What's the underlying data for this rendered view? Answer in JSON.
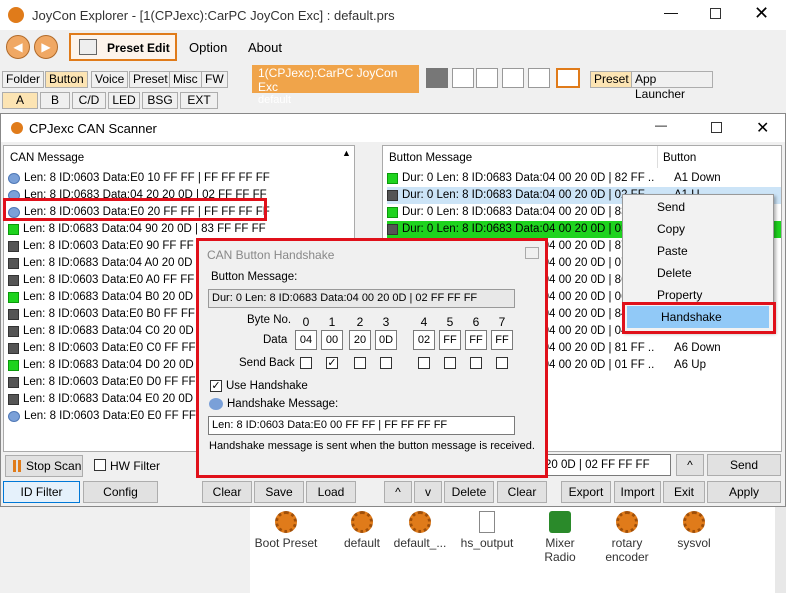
{
  "window_title": "JoyCon Explorer - [1(CPJexc):CarPC JoyCon Exc] : default.prs",
  "menu": {
    "preset_edit": "Preset Edit",
    "option": "Option",
    "about": "About"
  },
  "category_tabs": [
    "Folder",
    "Button",
    "Voice",
    "Preset",
    "Misc",
    "FW"
  ],
  "sub_tabs": [
    "A",
    "B",
    "C/D",
    "LED",
    "BSG",
    "EXT"
  ],
  "doc_tab": {
    "title": "1(CPJexc):CarPC JoyCon Exc",
    "subtitle": "default"
  },
  "right_tabs": [
    "Preset",
    "App Launcher"
  ],
  "scanner": {
    "title": "CPJexc CAN Scanner",
    "can_header": "CAN Message",
    "can_rows": [
      {
        "text": "Len: 8 ID:0603 Data:E0 10 FF FF | FF FF FF FF",
        "icon": "blue"
      },
      {
        "text": "Len: 8 ID:0683 Data:04 20 20 0D | 02 FF FF FF",
        "icon": "blue"
      },
      {
        "text": "Len: 8 ID:0603 Data:E0 20 FF FF | FF FF FF FF",
        "icon": "blue"
      },
      {
        "text": "Len: 8 ID:0683 Data:04 90 20 0D | 83 FF FF FF",
        "icon": "green"
      },
      {
        "text": "Len: 8 ID:0603 Data:E0 90 FF FF | F",
        "icon": "dark"
      },
      {
        "text": "Len: 8 ID:0683 Data:04 A0 20 0D | 0",
        "icon": "dark"
      },
      {
        "text": "Len: 8 ID:0603 Data:E0 A0 FF FF | F",
        "icon": "dark"
      },
      {
        "text": "Len: 8 ID:0683 Data:04 B0 20 0D | 8",
        "icon": "green"
      },
      {
        "text": "Len: 8 ID:0603 Data:E0 B0 FF FF | F",
        "icon": "dark"
      },
      {
        "text": "Len: 8 ID:0683 Data:04 C0 20 0D | 8",
        "icon": "dark"
      },
      {
        "text": "Len: 8 ID:0603 Data:E0 C0 FF FF | F",
        "icon": "dark"
      },
      {
        "text": "Len: 8 ID:0683 Data:04 D0 20 0D | 8",
        "icon": "green"
      },
      {
        "text": "Len: 8 ID:0603 Data:E0 D0 FF FF | F",
        "icon": "dark"
      },
      {
        "text": "Len: 8 ID:0683 Data:04 E0 20 0D | 0",
        "icon": "dark"
      },
      {
        "text": "Len: 8 ID:0603 Data:E0 E0 FF FF | F",
        "icon": "blue"
      }
    ],
    "btn_header": "Button Message",
    "btn_col_header": "Button",
    "btn_rows": [
      {
        "text": "Dur:  0 Len: 8 ID:0683 Data:04 00 20 0D | 82 FF ...",
        "btn": "A1 Down",
        "icon": "green"
      },
      {
        "text": "Dur:  0 Len: 8 ID:0683 Data:04 00 20 0D | 02 FF",
        "btn": "A1 U",
        "icon": "dark"
      },
      {
        "text": "Dur:  0 Len: 8 ID:0683 Data:04 00 20 0D | 83",
        "btn": "",
        "icon": "green"
      },
      {
        "text": "Dur:  0 Len: 8 ID:0683 Data:04 00 20 0D | 03",
        "btn": "",
        "icon": "dark"
      },
      {
        "text": "Dur:  0 Len: 8 ID:0683 Data:04 00 20 0D | 87",
        "btn": "",
        "icon": "green"
      },
      {
        "text": "Dur:  0 Len: 8 ID:0683 Data:04 00 20 0D | 07",
        "btn": "",
        "icon": "dark"
      },
      {
        "text": "Dur:  0 Len: 8 ID:0683 Data:04 00 20 0D | 86",
        "btn": "",
        "icon": "green"
      },
      {
        "text": "Dur:  0 Len: 8 ID:0683 Data:04 00 20 0D | 06",
        "btn": "",
        "icon": "dark"
      },
      {
        "text": "Dur:  0 Len: 8 ID:0683 Data:04 00 20 0D | 84",
        "btn": "",
        "icon": "green"
      },
      {
        "text": "Dur:  0 Len: 8 ID:0683 Data:04 00 20 0D | 04",
        "btn": "",
        "icon": "dark"
      },
      {
        "text": "Dur:  0 Len: 8 ID:0683 Data:04 00 20 0D | 81 FF ...",
        "btn": "A6 Down",
        "icon": "green"
      },
      {
        "text": "Dur:  0 Len: 8 ID:0683 Data:04 00 20 0D | 01 FF ...",
        "btn": "A6 Up",
        "icon": "dark"
      }
    ],
    "stop_scan": "Stop Scan",
    "hw_filter": "HW Filter",
    "id_filter": "ID Filter",
    "config": "Config",
    "clear": "Clear",
    "save": "Save",
    "load": "Load",
    "up": "^",
    "down": "v",
    "delete": "Delete",
    "clear2": "Clear",
    "export": "Export",
    "import": "Import",
    "exit": "Exit",
    "apply": "Apply",
    "send_field": "20 0D | 02 FF FF FF",
    "send": "Send",
    "send_up": "^"
  },
  "context_menu": [
    "Send",
    "Copy",
    "Paste",
    "Delete",
    "Property",
    "Handshake"
  ],
  "dialog": {
    "title": "CAN Button Handshake",
    "button_message_label": "Button Message:",
    "button_message": "Dur:  0 Len: 8 ID:0683 Data:04 00 20 0D | 02 FF FF FF",
    "byte_no": "Byte No.",
    "data": "Data",
    "send_back": "Send Back",
    "bytes": [
      "0",
      "1",
      "2",
      "3",
      "4",
      "5",
      "6",
      "7"
    ],
    "values": [
      "04",
      "00",
      "20",
      "0D",
      "02",
      "FF",
      "FF",
      "FF"
    ],
    "send_back_checked": [
      false,
      true,
      false,
      false,
      false,
      false,
      false,
      false
    ],
    "use_handshake": "Use Handshake",
    "handshake_label": "Handshake Message:",
    "handshake_message": "Len: 8 ID:0603 Data:E0 00 FF FF | FF FF FF FF",
    "note": "Handshake message is sent when the button message is received."
  },
  "presets": [
    "Boot Preset",
    "default",
    "default_...",
    "hs_output",
    "Mixer\nRadio",
    "rotary\nencoder",
    "sysvol"
  ]
}
